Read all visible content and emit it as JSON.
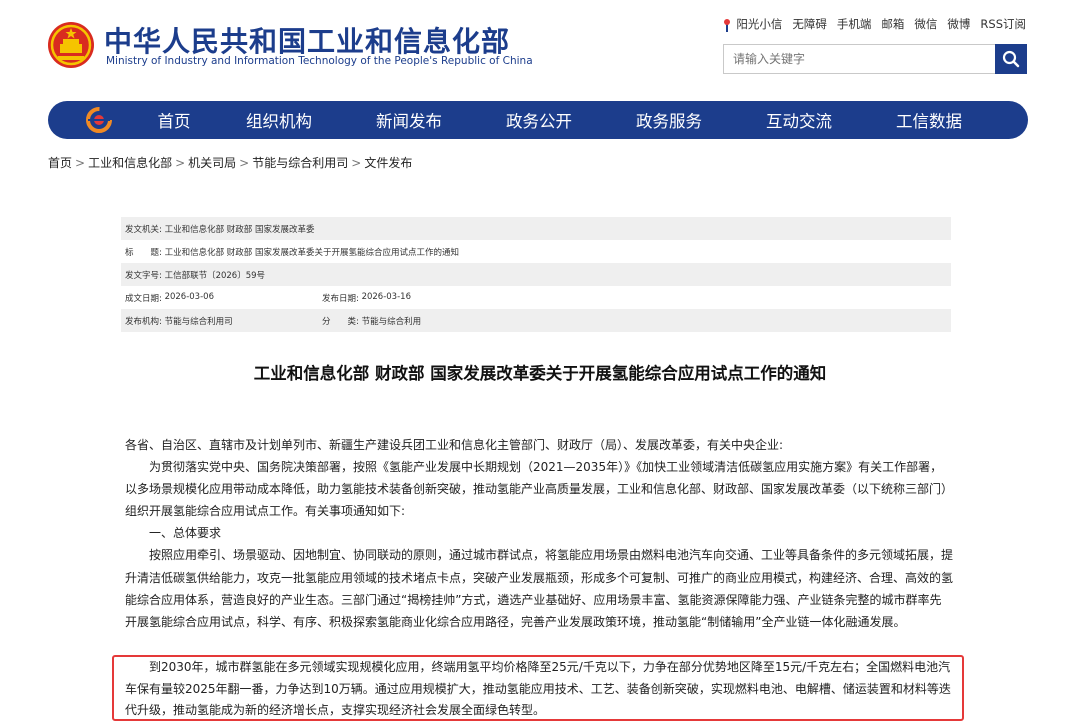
{
  "header": {
    "title_cn": "中华人民共和国工业和信息化部",
    "title_en": "Ministry of Industry and Information Technology of the People's Republic of China",
    "top_links": [
      "阳光小信",
      "无障碍",
      "手机端",
      "邮箱",
      "微信",
      "微博",
      "RSS订阅"
    ],
    "search_placeholder": "请输入关键字"
  },
  "nav": {
    "items": [
      "首页",
      "组织机构",
      "新闻发布",
      "政务公开",
      "政务服务",
      "互动交流",
      "工信数据"
    ]
  },
  "breadcrumb": [
    "首页",
    "工业和信息化部",
    "机关司局",
    "节能与综合利用司",
    "文件发布"
  ],
  "meta": {
    "issuer_label": "发文机关:",
    "issuer": "工业和信息化部 财政部 国家发展改革委",
    "title_label": "标　　题:",
    "title": "工业和信息化部 财政部 国家发展改革委关于开展氢能综合应用试点工作的通知",
    "docno_label": "发文字号:",
    "docno": "工信部联节〔2026〕59号",
    "created_label": "成文日期:",
    "created": "2026-03-06",
    "published_label": "发布日期:",
    "published": "2026-03-16",
    "org_label": "发布机构:",
    "org": "节能与综合利用司",
    "category_label": "分　　类:",
    "category": "节能与综合利用"
  },
  "document": {
    "title": "工业和信息化部 财政部 国家发展改革委关于开展氢能综合应用试点工作的通知",
    "salutation": "各省、自治区、直辖市及计划单列市、新疆生产建设兵团工业和信息化主管部门、财政厅（局）、发展改革委，有关中央企业:",
    "para1": "为贯彻落实党中央、国务院决策部署，按照《氢能产业发展中长期规划（2021—2035年）》《加快工业领域清洁低碳氢应用实施方案》有关工作部署，以多场景规模化应用带动成本降低，助力氢能技术装备创新突破，推动氢能产业高质量发展，工业和信息化部、财政部、国家发展改革委（以下统称三部门）组织开展氢能综合应用试点工作。有关事项通知如下:",
    "section1": "一、总体要求",
    "para2": "按照应用牵引、场景驱动、因地制宜、协同联动的原则，通过城市群试点，将氢能应用场景由燃料电池汽车向交通、工业等具备条件的多元领域拓展，提升清洁低碳氢供给能力，攻克一批氢能应用领域的技术堵点卡点，突破产业发展瓶颈，形成多个可复制、可推广的商业应用模式，构建经济、合理、高效的氢能综合应用体系，营造良好的产业生态。三部门通过“揭榜挂帅”方式，遴选产业基础好、应用场景丰富、氢能资源保障能力强、产业链条完整的城市群率先开展氢能综合应用试点，科学、有序、积极探索氢能商业化综合应用路径，完善产业发展政策环境，推动氢能“制储输用”全产业链一体化融通发展。",
    "para3": "到2030年，城市群氢能在多元领域实现规模化应用，终端用氢平均价格降至25元/千克以下，力争在部分优势地区降至15元/千克左右；全国燃料电池汽车保有量较2025年翻一番，力争达到10万辆。通过应用规模扩大，推动氢能应用技术、工艺、装备创新突破，实现燃料电池、电解槽、储运装置和材料等迭代升级，推动氢能成为新的经济增长点，支撑实现经济社会发展全面绿色转型。"
  },
  "colors": {
    "brand": "#1c3d8c",
    "highlight_border": "#e53939",
    "meta_shade": "#efefef"
  },
  "icons": [
    "national-emblem-icon",
    "sun-icon",
    "search-icon",
    "miit-logo-icon"
  ]
}
